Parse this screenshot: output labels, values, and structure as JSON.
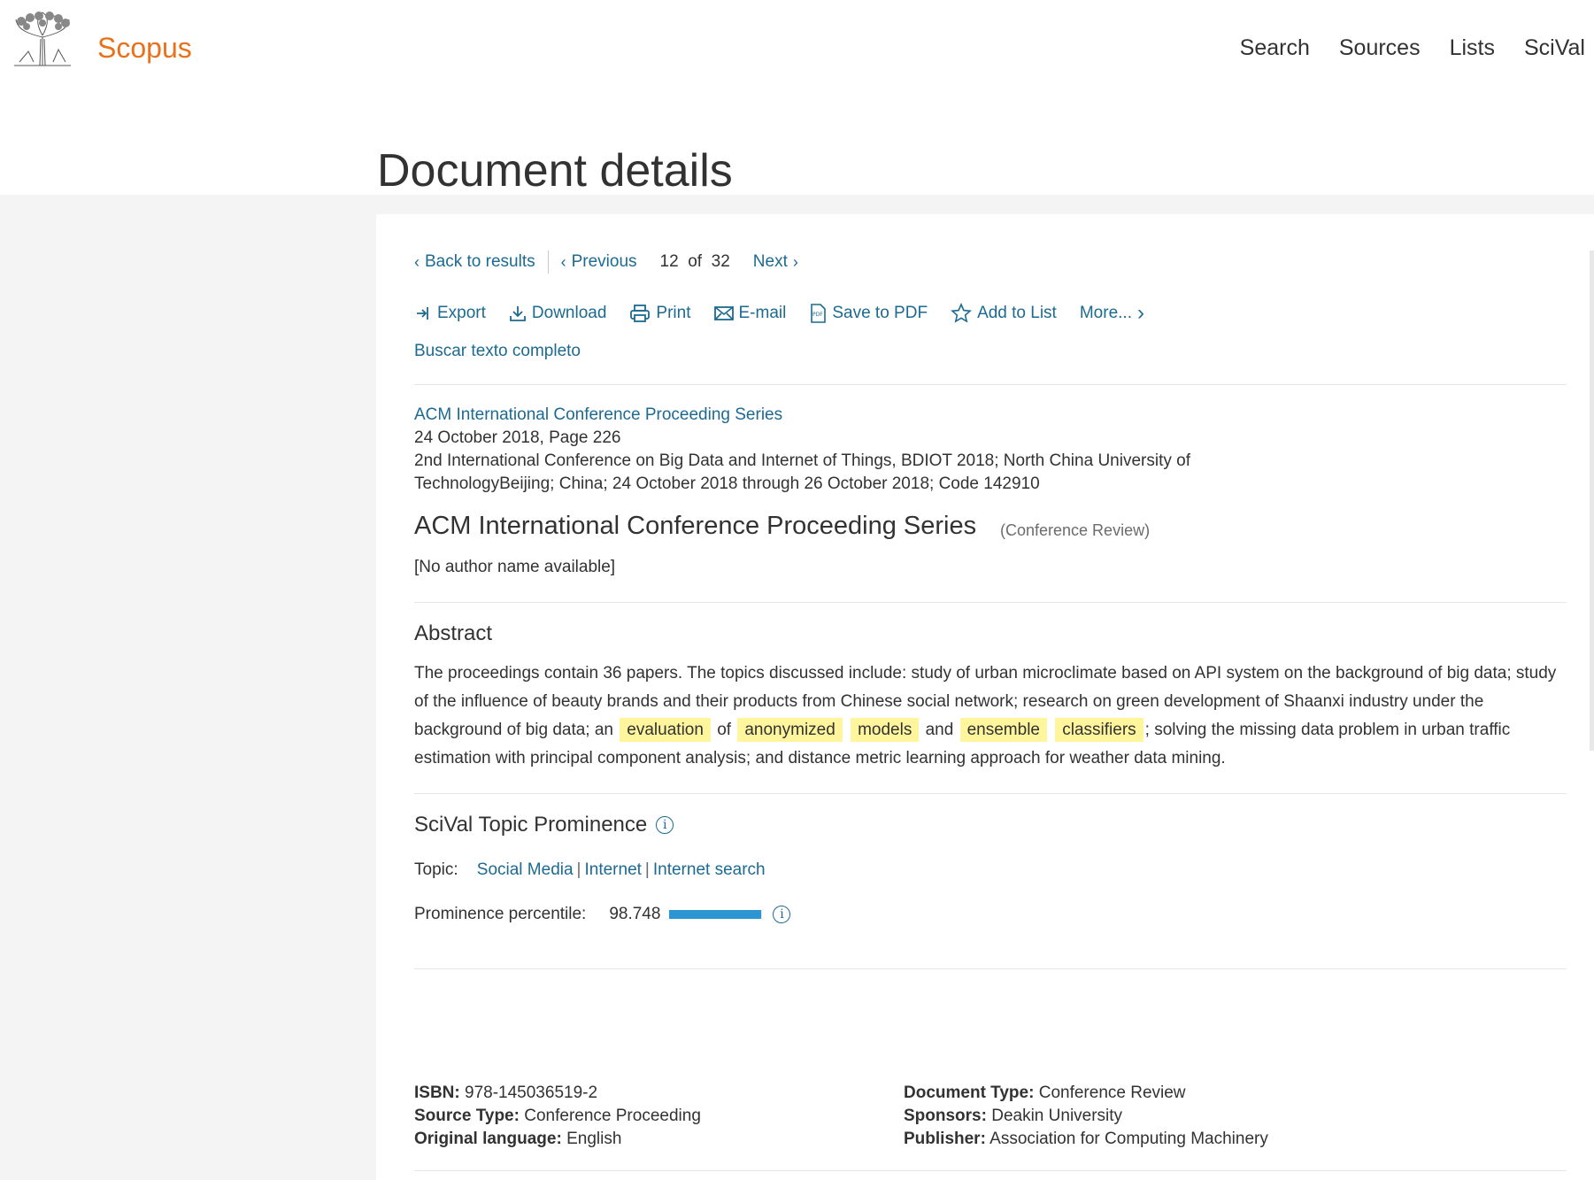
{
  "brand": {
    "name": "Scopus"
  },
  "nav": [
    "Search",
    "Sources",
    "Lists",
    "SciVal"
  ],
  "page_title": "Document details",
  "pager": {
    "back": "Back to results",
    "previous": "Previous",
    "current": "12",
    "of": "of",
    "total": "32",
    "next": "Next"
  },
  "actions": {
    "export": "Export",
    "download": "Download",
    "print": "Print",
    "email": "E-mail",
    "save_pdf": "Save to PDF",
    "add_list": "Add to List",
    "more": "More..."
  },
  "fulltext_link": "Buscar texto completo",
  "source": {
    "series": "ACM International Conference Proceeding Series",
    "date_page": "24 October 2018, Page 226",
    "conference": "2nd International Conference on Big Data and Internet of Things, BDIOT 2018; North China University of TechnologyBeijing; China; 24 October 2018 through 26 October 2018; Code 142910"
  },
  "document": {
    "title": "ACM International Conference Proceeding Series",
    "type_label": "(Conference Review)",
    "authors": "[No author name available]"
  },
  "abstract": {
    "heading": "Abstract",
    "text_before": "The proceedings contain 36 papers. The topics discussed include: study of urban microclimate based on API system on the background of big data; study of the influence of beauty brands and their products from Chinese social network; research on green development of Shaanxi industry under the background of big data; an",
    "hl1": "evaluation",
    "w_of": "of",
    "hl2": "anonymized",
    "hl3": "models",
    "w_and": "and",
    "hl4": "ensemble",
    "hl5": "classifiers",
    "text_after": "; solving the missing data problem in urban traffic estimation with principal component analysis; and distance metric learning approach for weather data mining."
  },
  "scival": {
    "heading": "SciVal Topic Prominence",
    "topic_label": "Topic:",
    "topics": [
      "Social Media",
      "Internet",
      "Internet search"
    ],
    "prominence_label": "Prominence percentile:",
    "prominence_value": "98.748",
    "prominence_fraction": 0.987
  },
  "meta_left": [
    {
      "label": "ISBN:",
      "value": "978-145036519-2"
    },
    {
      "label": "Source Type:",
      "value": "Conference Proceeding"
    },
    {
      "label": "Original language:",
      "value": "English"
    }
  ],
  "meta_right": [
    {
      "label": "Document Type:",
      "value": "Conference Review"
    },
    {
      "label": "Sponsors:",
      "value": "Deakin University"
    },
    {
      "label": "Publisher:",
      "value": "Association for Computing Machinery"
    }
  ],
  "colors": {
    "brand": "#e9711c",
    "link": "#1c6a91",
    "highlight": "#fff59d",
    "bar": "#2e95d3"
  }
}
